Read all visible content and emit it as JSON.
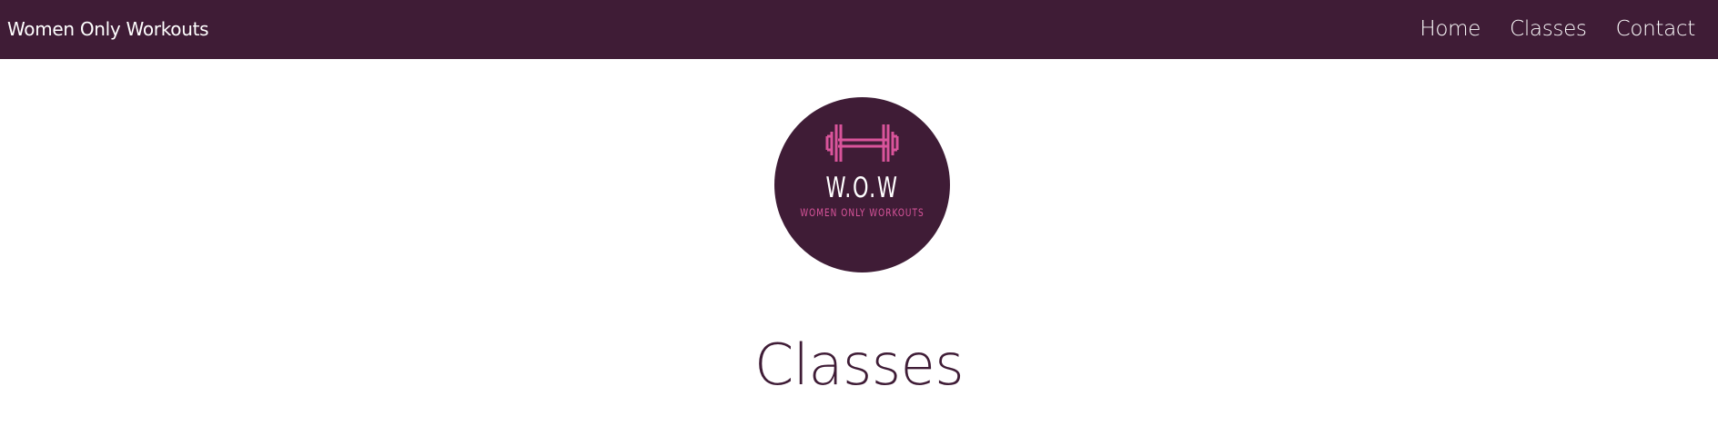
{
  "navbar": {
    "brand": "Women Only Workouts",
    "links": [
      {
        "label": "Home"
      },
      {
        "label": "Classes"
      },
      {
        "label": "Contact"
      }
    ]
  },
  "logo": {
    "title": "W.O.W",
    "subtitle": "WOMEN ONLY WORKOUTS",
    "icon": "dumbbell-icon",
    "colors": {
      "circle": "#3f1c36",
      "accent": "#d9549b"
    }
  },
  "page": {
    "heading": "Classes"
  },
  "colors": {
    "primary": "#3f1c36",
    "background": "#ffffff",
    "nav_text": "#ffffff"
  }
}
